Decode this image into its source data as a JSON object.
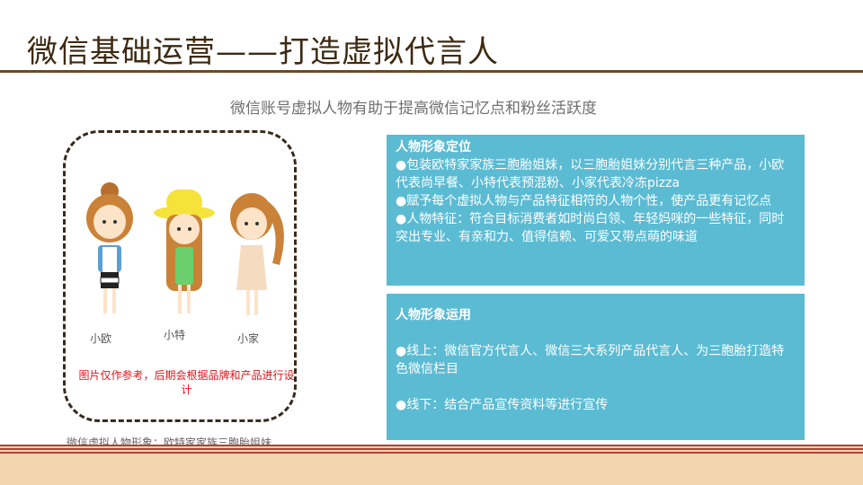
{
  "title": "微信基础运营——打造虚拟代言人",
  "subtitle": "微信账号虚拟人物有助于提高微信记忆点和粉丝活跃度",
  "figures": [
    {
      "label": "小欧"
    },
    {
      "label": "小特"
    },
    {
      "label": "小家"
    }
  ],
  "note": "图片仅作参考，后期会根据品牌和产品进行设计",
  "caption": "微信虚拟人物形象：欧特家家族三胞胎姐妹",
  "box1": {
    "heading": "人物形象定位",
    "lines": [
      "●包装欧特家家族三胞胎姐妹，以三胞胎姐妹分别代言三种产品，小欧代表尚早餐、小特代表预混粉、小家代表冷冻pizza",
      "●赋予每个虚拟人物与产品特征相符的人物个性，使产品更有记忆点",
      "●人物特征：符合目标消费者如时尚白领、年轻妈咪的一些特征，同时突出专业、有亲和力、值得信赖、可爱又带点萌的味道"
    ]
  },
  "box2": {
    "heading": "人物形象运用",
    "lines": [
      "●线上：微信官方代言人、微信三大系列产品代言人、为三胞胎打造特色微信栏目",
      "●线下：结合产品宣传资料等进行宣传"
    ]
  },
  "colors": {
    "box_bg": "#5bbbd3",
    "title_color": "#3d2a12",
    "note_color": "#e0151d",
    "floor": "#f3d6ad",
    "stripe": "#b24236"
  }
}
